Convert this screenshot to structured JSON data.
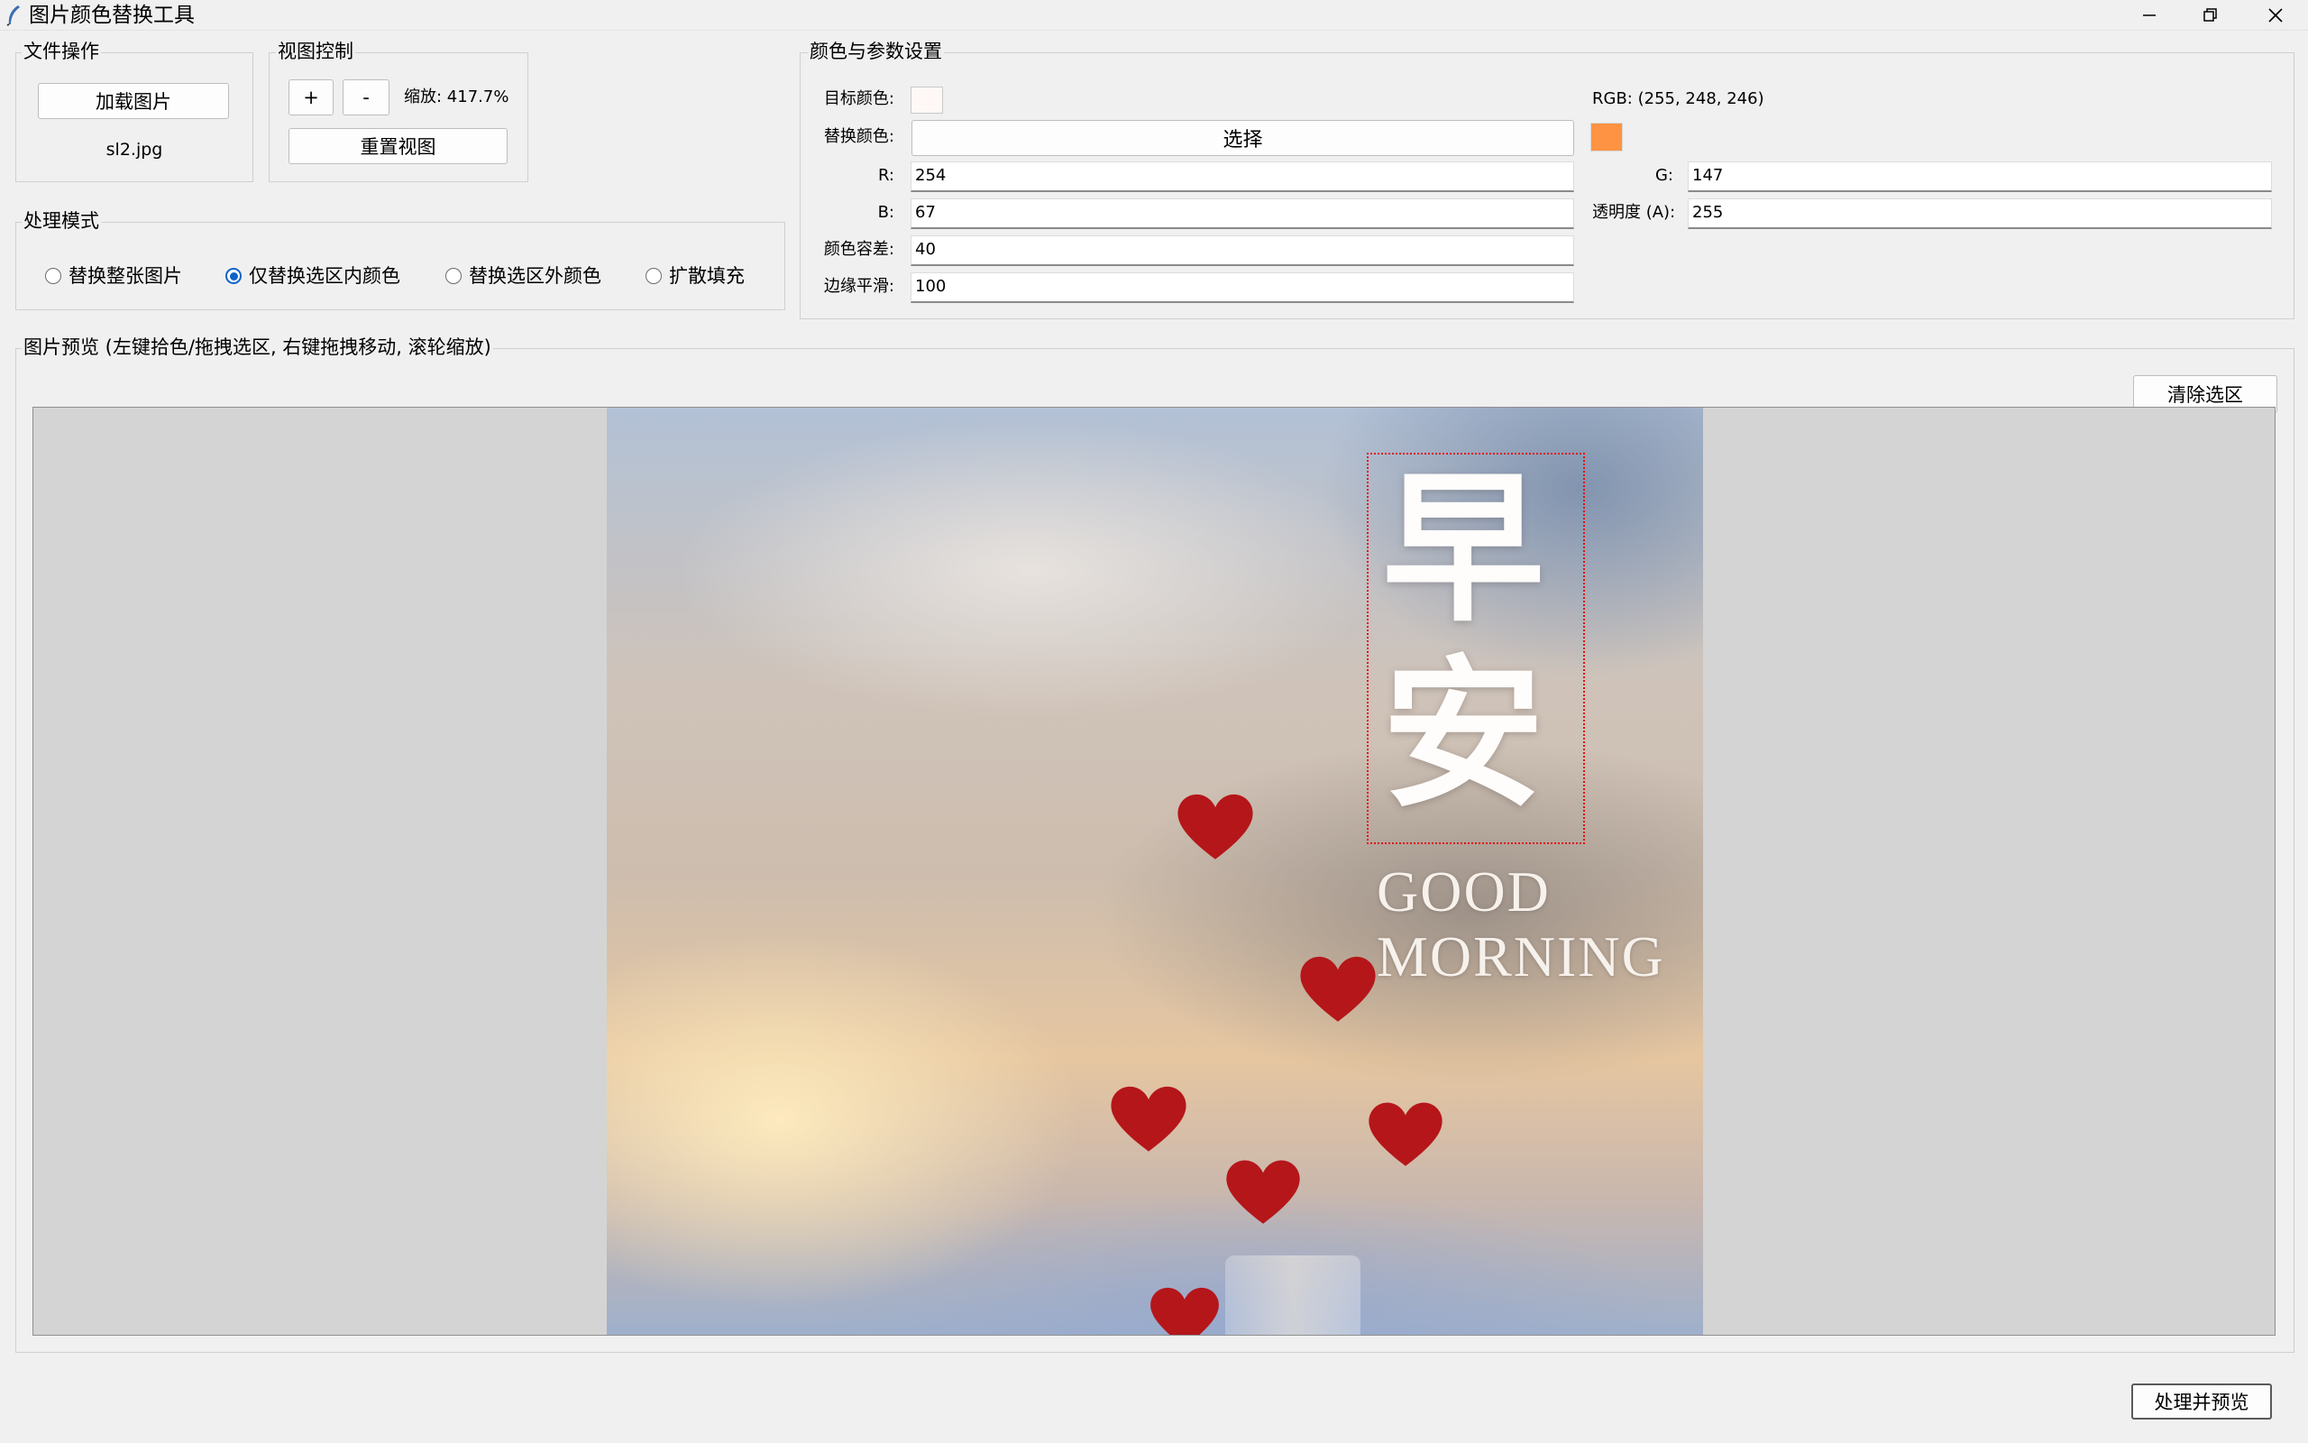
{
  "window": {
    "title": "图片颜色替换工具",
    "controls": [
      "minimize-icon",
      "restore-icon",
      "close-icon"
    ]
  },
  "file_ops": {
    "title": "文件操作",
    "load_button": "加载图片",
    "filename": "sl2.jpg"
  },
  "view_ctrl": {
    "title": "视图控制",
    "zoom_in": "+",
    "zoom_out": "-",
    "zoom_label": "缩放: 417.7%",
    "reset_button": "重置视图"
  },
  "mode": {
    "title": "处理模式",
    "options": [
      {
        "label": "替换整张图片",
        "selected": false
      },
      {
        "label": "仅替换选区内颜色",
        "selected": true
      },
      {
        "label": "替换选区外颜色",
        "selected": false
      },
      {
        "label": "扩散填充",
        "selected": false
      }
    ]
  },
  "params": {
    "title": "颜色与参数设置",
    "target_label": "目标颜色:",
    "target_color": "#fff8f6",
    "target_rgb": "RGB: (255, 248, 246)",
    "replace_label": "替换颜色:",
    "select_button": "选择",
    "replace_color": "#fe9343",
    "r_label": "R:",
    "r_value": "254",
    "g_label": "G:",
    "g_value": "147",
    "b_label": "B:",
    "b_value": "67",
    "a_label": "透明度 (A):",
    "a_value": "255",
    "tolerance_label": "颜色容差:",
    "tolerance_value": "40",
    "smooth_label": "边缘平滑:",
    "smooth_value": "100"
  },
  "preview": {
    "title": "图片预览 (左键拾色/拖拽选区, 右键拖拽移动, 滚轮缩放)",
    "clear_button": "清除选区",
    "image_text": {
      "line1": "早",
      "line2": "安",
      "en1": "GOOD",
      "en2": "MORNING"
    }
  },
  "process_button": "处理并预览"
}
